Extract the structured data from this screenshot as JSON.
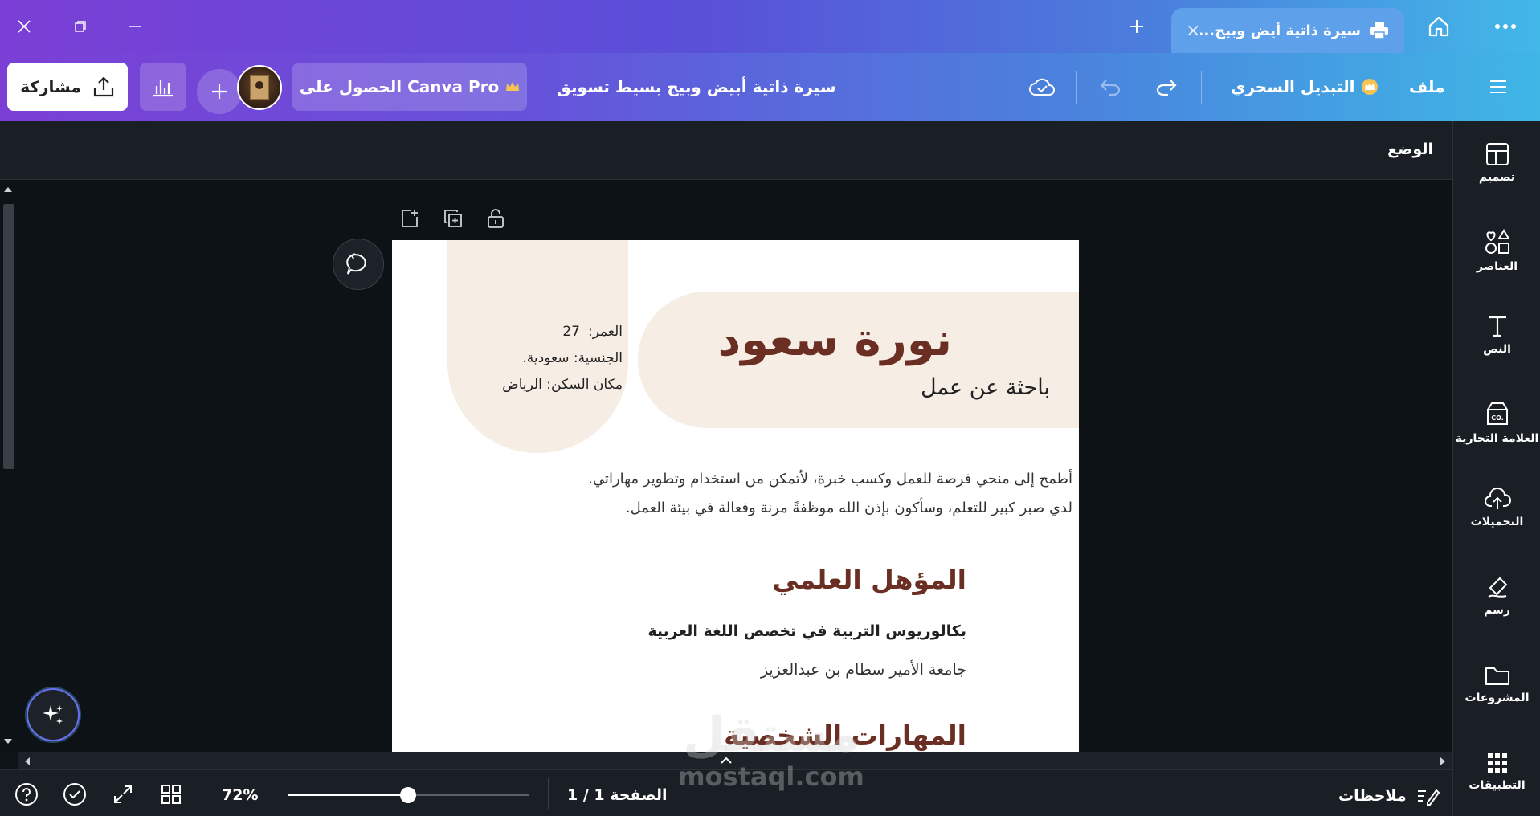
{
  "window": {
    "tab_title": "سيرة ذاتية أيض وبيج...",
    "close_label": "×",
    "new_tab_label": "+"
  },
  "toolbar": {
    "menu_file": "ملف",
    "magic_switch": "التبديل السحري",
    "doc_title": "سيرة ذاتية أبيض وبيج بسيط تسويق",
    "pro_label": "الحصول على Canva Pro",
    "share_label": "مشاركة"
  },
  "subheader": {
    "mode_label": "الوضع"
  },
  "sidebar": {
    "items": [
      {
        "label": "تصميم",
        "icon": "layout-icon"
      },
      {
        "label": "العناصر",
        "icon": "shapes-icon"
      },
      {
        "label": "النص",
        "icon": "text-icon"
      },
      {
        "label": "العلامة التجارية",
        "icon": "brand-icon"
      },
      {
        "label": "التحميلات",
        "icon": "upload-cloud-icon"
      },
      {
        "label": "رسم",
        "icon": "draw-icon"
      },
      {
        "label": "المشروعات",
        "icon": "folder-icon"
      },
      {
        "label": "التطبيقات",
        "icon": "apps-grid-icon"
      }
    ]
  },
  "resume": {
    "name": "نورة سعود",
    "role": "باحثة عن عمل",
    "age_label": "العمر:",
    "age_value": "27",
    "nationality": "الجنسية: سعودية.",
    "residence": "مكان السكن: الرياض",
    "summary_line1": "أطمح إلى منحي فرصة للعمل وكسب خبرة، لأتمكن من استخدام وتطوير مهاراتي.",
    "summary_line2": "لدي صبر كبير للتعلم، وسأكون بإذن الله موظفةً مرنة وفعالة في بيئة العمل.",
    "education_title": "المؤهل العلمي",
    "degree": "بكالوريوس التربية في تخصص اللغة العربية",
    "university": "جامعة الأمير سطام بن عبدالعزيز",
    "skills_title": "المهارات الشخصية"
  },
  "bottombar": {
    "notes_label": "ملاحظات",
    "page_label": "الصفحة 1 / 1",
    "zoom_label": "72%",
    "zoom_value": 0.5
  },
  "watermark": {
    "arabic": "مستقل",
    "latin": "mostaql.com"
  },
  "colors": {
    "accent_brown": "#6b2e22",
    "beige": "#f6ede4",
    "canvas_bg": "#0d1217",
    "panel_bg": "#1a1f25"
  }
}
